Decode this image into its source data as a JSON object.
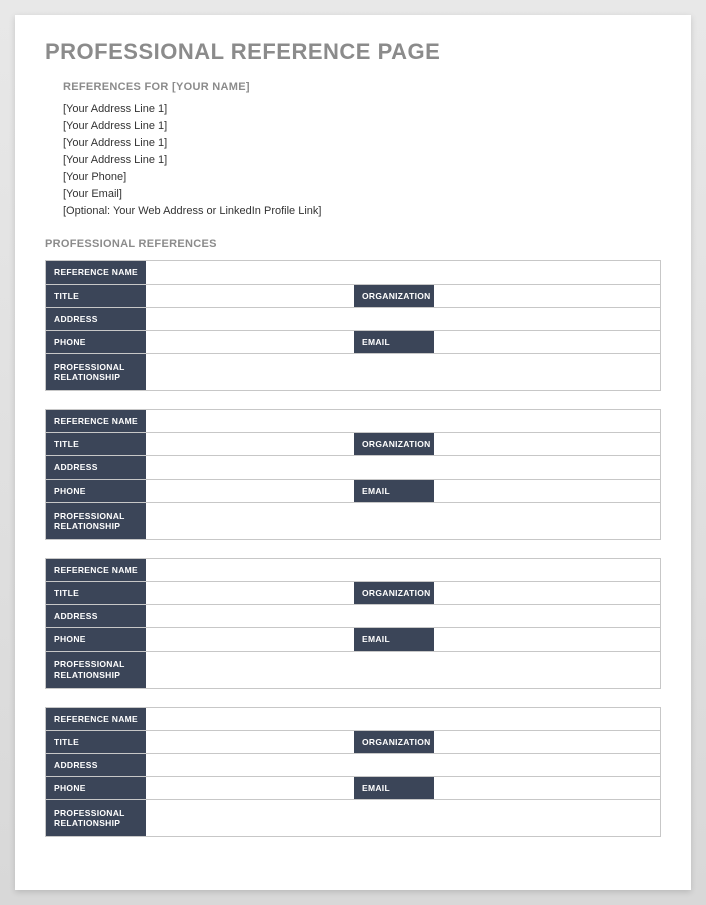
{
  "doc_title": "PROFESSIONAL REFERENCE PAGE",
  "references_for_heading": "REFERENCES FOR [YOUR NAME]",
  "address_lines": [
    "[Your Address Line 1]",
    "[Your Address Line 1]",
    "[Your Address Line 1]",
    "[Your Address Line 1]",
    "[Your Phone]",
    "[Your Email]",
    "[Optional: Your Web Address or LinkedIn Profile Link]"
  ],
  "professional_references_heading": "PROFESSIONAL REFERENCES",
  "field_labels": {
    "reference_name": "REFERENCE NAME",
    "title": "TITLE",
    "organization": "ORGANIZATION",
    "address": "ADDRESS",
    "phone": "PHONE",
    "email": "EMAIL",
    "professional_relationship": "PROFESSIONAL RELATIONSHIP"
  },
  "references": [
    {
      "reference_name": "",
      "title": "",
      "organization": "",
      "address": "",
      "phone": "",
      "email": "",
      "professional_relationship": ""
    },
    {
      "reference_name": "",
      "title": "",
      "organization": "",
      "address": "",
      "phone": "",
      "email": "",
      "professional_relationship": ""
    },
    {
      "reference_name": "",
      "title": "",
      "organization": "",
      "address": "",
      "phone": "",
      "email": "",
      "professional_relationship": ""
    },
    {
      "reference_name": "",
      "title": "",
      "organization": "",
      "address": "",
      "phone": "",
      "email": "",
      "professional_relationship": ""
    }
  ]
}
